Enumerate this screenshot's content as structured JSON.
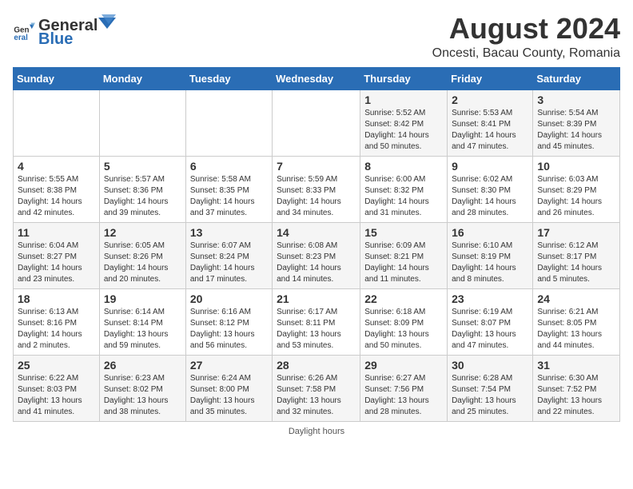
{
  "header": {
    "logo_general": "General",
    "logo_blue": "Blue",
    "month_year": "August 2024",
    "location": "Oncesti, Bacau County, Romania"
  },
  "days_of_week": [
    "Sunday",
    "Monday",
    "Tuesday",
    "Wednesday",
    "Thursday",
    "Friday",
    "Saturday"
  ],
  "weeks": [
    [
      {
        "day": "",
        "info": ""
      },
      {
        "day": "",
        "info": ""
      },
      {
        "day": "",
        "info": ""
      },
      {
        "day": "",
        "info": ""
      },
      {
        "day": "1",
        "info": "Sunrise: 5:52 AM\nSunset: 8:42 PM\nDaylight: 14 hours and 50 minutes."
      },
      {
        "day": "2",
        "info": "Sunrise: 5:53 AM\nSunset: 8:41 PM\nDaylight: 14 hours and 47 minutes."
      },
      {
        "day": "3",
        "info": "Sunrise: 5:54 AM\nSunset: 8:39 PM\nDaylight: 14 hours and 45 minutes."
      }
    ],
    [
      {
        "day": "4",
        "info": "Sunrise: 5:55 AM\nSunset: 8:38 PM\nDaylight: 14 hours and 42 minutes."
      },
      {
        "day": "5",
        "info": "Sunrise: 5:57 AM\nSunset: 8:36 PM\nDaylight: 14 hours and 39 minutes."
      },
      {
        "day": "6",
        "info": "Sunrise: 5:58 AM\nSunset: 8:35 PM\nDaylight: 14 hours and 37 minutes."
      },
      {
        "day": "7",
        "info": "Sunrise: 5:59 AM\nSunset: 8:33 PM\nDaylight: 14 hours and 34 minutes."
      },
      {
        "day": "8",
        "info": "Sunrise: 6:00 AM\nSunset: 8:32 PM\nDaylight: 14 hours and 31 minutes."
      },
      {
        "day": "9",
        "info": "Sunrise: 6:02 AM\nSunset: 8:30 PM\nDaylight: 14 hours and 28 minutes."
      },
      {
        "day": "10",
        "info": "Sunrise: 6:03 AM\nSunset: 8:29 PM\nDaylight: 14 hours and 26 minutes."
      }
    ],
    [
      {
        "day": "11",
        "info": "Sunrise: 6:04 AM\nSunset: 8:27 PM\nDaylight: 14 hours and 23 minutes."
      },
      {
        "day": "12",
        "info": "Sunrise: 6:05 AM\nSunset: 8:26 PM\nDaylight: 14 hours and 20 minutes."
      },
      {
        "day": "13",
        "info": "Sunrise: 6:07 AM\nSunset: 8:24 PM\nDaylight: 14 hours and 17 minutes."
      },
      {
        "day": "14",
        "info": "Sunrise: 6:08 AM\nSunset: 8:23 PM\nDaylight: 14 hours and 14 minutes."
      },
      {
        "day": "15",
        "info": "Sunrise: 6:09 AM\nSunset: 8:21 PM\nDaylight: 14 hours and 11 minutes."
      },
      {
        "day": "16",
        "info": "Sunrise: 6:10 AM\nSunset: 8:19 PM\nDaylight: 14 hours and 8 minutes."
      },
      {
        "day": "17",
        "info": "Sunrise: 6:12 AM\nSunset: 8:17 PM\nDaylight: 14 hours and 5 minutes."
      }
    ],
    [
      {
        "day": "18",
        "info": "Sunrise: 6:13 AM\nSunset: 8:16 PM\nDaylight: 14 hours and 2 minutes."
      },
      {
        "day": "19",
        "info": "Sunrise: 6:14 AM\nSunset: 8:14 PM\nDaylight: 13 hours and 59 minutes."
      },
      {
        "day": "20",
        "info": "Sunrise: 6:16 AM\nSunset: 8:12 PM\nDaylight: 13 hours and 56 minutes."
      },
      {
        "day": "21",
        "info": "Sunrise: 6:17 AM\nSunset: 8:11 PM\nDaylight: 13 hours and 53 minutes."
      },
      {
        "day": "22",
        "info": "Sunrise: 6:18 AM\nSunset: 8:09 PM\nDaylight: 13 hours and 50 minutes."
      },
      {
        "day": "23",
        "info": "Sunrise: 6:19 AM\nSunset: 8:07 PM\nDaylight: 13 hours and 47 minutes."
      },
      {
        "day": "24",
        "info": "Sunrise: 6:21 AM\nSunset: 8:05 PM\nDaylight: 13 hours and 44 minutes."
      }
    ],
    [
      {
        "day": "25",
        "info": "Sunrise: 6:22 AM\nSunset: 8:03 PM\nDaylight: 13 hours and 41 minutes."
      },
      {
        "day": "26",
        "info": "Sunrise: 6:23 AM\nSunset: 8:02 PM\nDaylight: 13 hours and 38 minutes."
      },
      {
        "day": "27",
        "info": "Sunrise: 6:24 AM\nSunset: 8:00 PM\nDaylight: 13 hours and 35 minutes."
      },
      {
        "day": "28",
        "info": "Sunrise: 6:26 AM\nSunset: 7:58 PM\nDaylight: 13 hours and 32 minutes."
      },
      {
        "day": "29",
        "info": "Sunrise: 6:27 AM\nSunset: 7:56 PM\nDaylight: 13 hours and 28 minutes."
      },
      {
        "day": "30",
        "info": "Sunrise: 6:28 AM\nSunset: 7:54 PM\nDaylight: 13 hours and 25 minutes."
      },
      {
        "day": "31",
        "info": "Sunrise: 6:30 AM\nSunset: 7:52 PM\nDaylight: 13 hours and 22 minutes."
      }
    ]
  ],
  "footer": {
    "daylight_hours_label": "Daylight hours"
  }
}
